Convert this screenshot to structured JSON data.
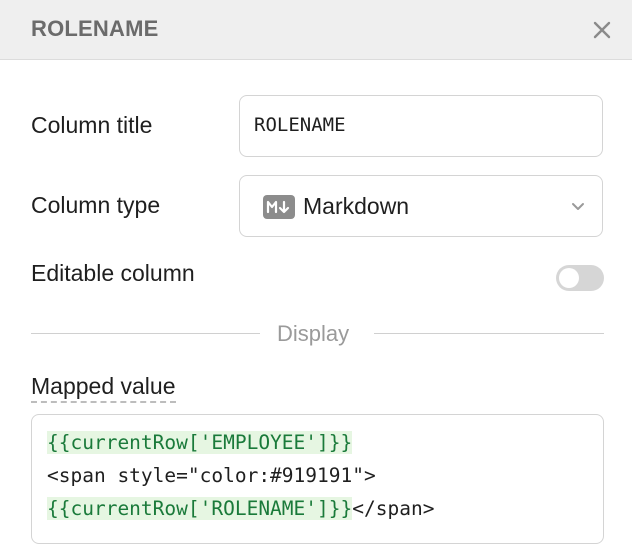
{
  "header": {
    "title": "ROLENAME"
  },
  "icons": {
    "close": "close-icon",
    "markdown": "markdown-icon",
    "chevron": "chevron-down-icon"
  },
  "form": {
    "column_title": {
      "label": "Column title",
      "value": "ROLENAME"
    },
    "column_type": {
      "label": "Column type",
      "value": "Markdown"
    },
    "editable": {
      "label": "Editable column",
      "enabled": false
    },
    "section_divider": "Display",
    "mapped_value": {
      "label": "Mapped value",
      "line1_expr": "{{currentRow['EMPLOYEE']}}",
      "line2": "<span style=\"color:#919191\">",
      "line3_expr": "{{currentRow['ROLENAME']}}",
      "line3_tail": "</span>"
    }
  },
  "colors": {
    "header_bg": "#efefef",
    "header_text": "#6b6b6b",
    "toggle_off": "#d6d6d6",
    "expr_bg": "#e6f6e2",
    "expr_text": "#1a7a3a"
  }
}
